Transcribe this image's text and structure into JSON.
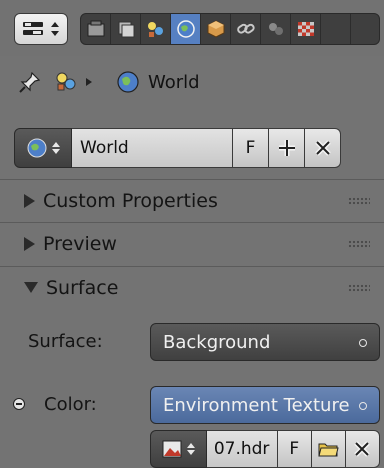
{
  "breadcrumb": {
    "context": "World"
  },
  "world_datablock": {
    "name": "World",
    "fake_user_label": "F"
  },
  "panels": [
    {
      "label": "Custom Properties",
      "expanded": false
    },
    {
      "label": "Preview",
      "expanded": false
    },
    {
      "label": "Surface",
      "expanded": true
    }
  ],
  "surface": {
    "surface_label": "Surface:",
    "surface_value": "Background",
    "color_label": "Color:",
    "color_value": "Environment Texture"
  },
  "image_datablock": {
    "name": "07.hdr",
    "fake_user_label": "F"
  },
  "properties_tabs": [
    "render-icon",
    "render-layers-icon",
    "scene-icon",
    "world-icon",
    "object-icon",
    "constraints-icon",
    "modifiers-icon",
    "texture-icon"
  ],
  "active_tab": "world-icon",
  "colors": {
    "active_tab": "#5680c2",
    "link_field": "#5b78a8",
    "panel_bg": "#737373"
  }
}
